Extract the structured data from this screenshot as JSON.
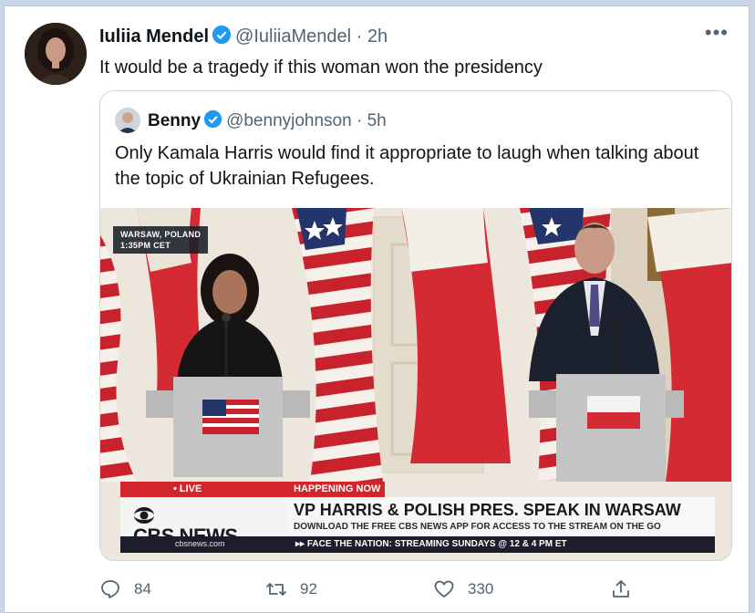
{
  "tweet": {
    "author_name": "Iuliia Mendel",
    "handle": "@IuliiaMendel",
    "time": "2h",
    "separator": "·",
    "more": "•••",
    "text": "It would be a tragedy if this woman won the presidency"
  },
  "quote": {
    "author_name": "Benny",
    "handle": "@bennyjohnson",
    "time": "5h",
    "separator": "·",
    "text": "Only Kamala Harris would find it appropriate to laugh when talking about the topic of Ukrainian Refugees."
  },
  "video": {
    "location_line1": "WARSAW, POLAND",
    "location_line2": "1:35PM CET",
    "live_label": "• LIVE",
    "happening_label": "HAPPENING NOW",
    "network": "CBS NEWS",
    "headline": "VP HARRIS & POLISH PRES. SPEAK IN WARSAW",
    "subline": "DOWNLOAD THE FREE CBS NEWS APP FOR ACCESS TO THE STREAM ON THE GO",
    "url": "cbsnews.com",
    "ticker": "▸▸ FACE THE NATION: STREAMING SUNDAYS @ 12 & 4 PM ET"
  },
  "actions": {
    "reply_count": "84",
    "retweet_count": "92",
    "like_count": "330"
  },
  "colors": {
    "verified": "#1d9bf0",
    "text": "#0f1419",
    "secondary": "#536471",
    "cbs_red": "#d2262c"
  }
}
